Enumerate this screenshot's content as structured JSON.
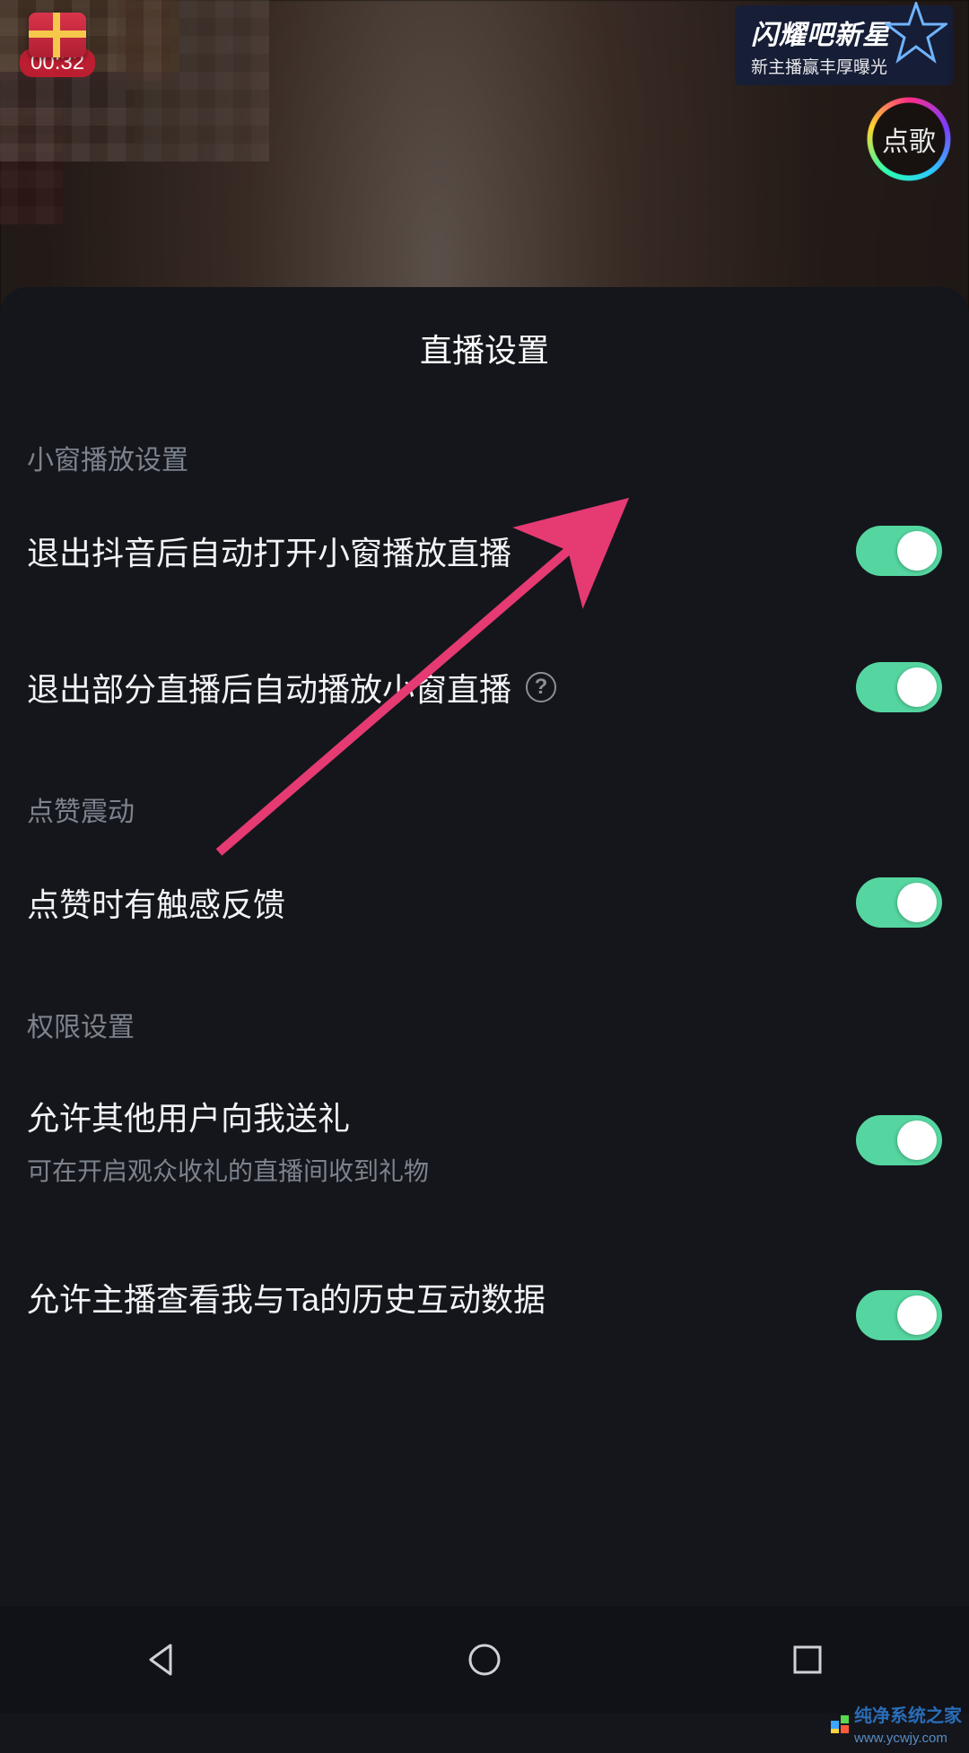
{
  "video": {
    "duration": "00:32",
    "promo_title": "闪耀吧新星",
    "promo_subtitle": "新主播赢丰厚曝光",
    "song_request_label": "点歌"
  },
  "sheet": {
    "title": "直播设置",
    "sections": [
      {
        "label": "小窗播放设置",
        "rows": [
          {
            "title": "退出抖音后自动打开小窗播放直播",
            "help": false,
            "on": true
          },
          {
            "title": "退出部分直播后自动播放小窗直播",
            "help": true,
            "on": true
          }
        ]
      },
      {
        "label": "点赞震动",
        "rows": [
          {
            "title": "点赞时有触感反馈",
            "help": false,
            "on": true
          }
        ]
      },
      {
        "label": "权限设置",
        "rows": [
          {
            "title": "允许其他用户向我送礼",
            "sub": "可在开启观众收礼的直播间收到礼物",
            "help": false,
            "on": true
          },
          {
            "title": "允许主播查看我与Ta的历史互动数据",
            "help": false,
            "on": true
          }
        ]
      }
    ]
  },
  "colors": {
    "toggle_on": "#55d6a0",
    "accent_arrow": "#e63a72",
    "sheet_bg": "#14161c"
  },
  "watermark": {
    "text": "纯净系统之家",
    "url": "www.ycwjy.com"
  }
}
